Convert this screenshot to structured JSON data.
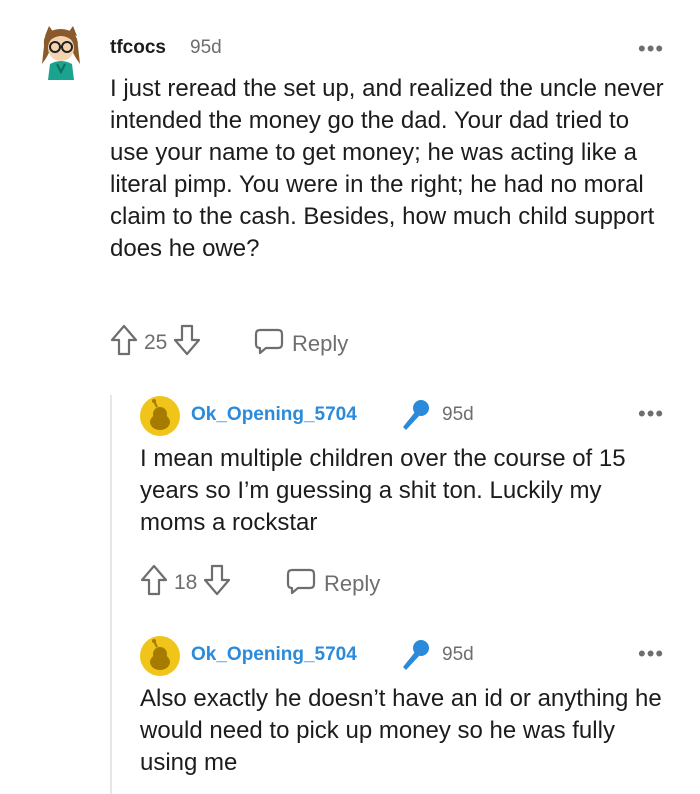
{
  "comments": [
    {
      "username": "tfcocs",
      "time": "95d",
      "body": "I just reread the set up, and realized the uncle never intended the money go the dad. Your dad tried to use your name to get money; he was acting like a literal pimp. You were in the right; he had no moral claim to the cash. Besides, how much child support does he owe?",
      "votes": "25",
      "reply_label": "Reply",
      "more": "•••"
    },
    {
      "username": "Ok_Opening_5704",
      "time": "95d",
      "body": "I mean multiple children over the course of 15 years so I’m guessing a shit ton. Luckily my moms a rockstar",
      "votes": "18",
      "reply_label": "Reply",
      "more": "•••"
    },
    {
      "username": "Ok_Opening_5704",
      "time": "95d",
      "body": "Also exactly he doesn’t have an id or anything he would need to pick up money so he was fully using me",
      "more": "•••"
    }
  ],
  "colors": {
    "op_blue": "#2b8ad9",
    "meta_gray": "#6e6e6e",
    "text": "#1c1c1c"
  }
}
